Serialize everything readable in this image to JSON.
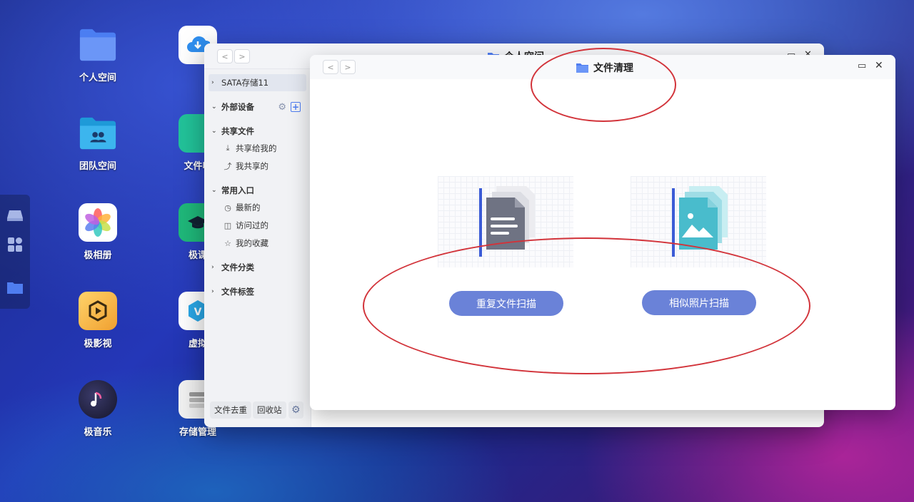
{
  "desktop": {
    "icons": [
      {
        "label": "个人空间",
        "icon": "folder-icon"
      },
      {
        "label": "团队空间",
        "icon": "team-folder-icon"
      },
      {
        "label": "极相册",
        "icon": "photos-icon"
      },
      {
        "label": "极影视",
        "icon": "video-icon"
      },
      {
        "label": "极音乐",
        "icon": "music-icon"
      },
      {
        "label": "",
        "icon": "download-icon"
      },
      {
        "label": "文件收",
        "icon": "file-collect-icon"
      },
      {
        "label": "极课",
        "icon": "graduation-cap-icon"
      },
      {
        "label": "虚拟",
        "icon": "virtual-machine-icon"
      },
      {
        "label": "存储管理",
        "icon": "storage-icon"
      }
    ]
  },
  "dock": {
    "items": [
      "drive-icon",
      "apps-grid-icon",
      "folder-icon"
    ]
  },
  "back_window": {
    "title": "个人空间",
    "sidebar": {
      "storage": "SATA存储11",
      "external": "外部设备",
      "shared": "共享文件",
      "shared_items": [
        "共享给我的",
        "我共享的"
      ],
      "common": "常用入口",
      "common_items": [
        "最新的",
        "访问过的",
        "我的收藏"
      ],
      "category": "文件分类",
      "tags": "文件标签"
    },
    "footer": {
      "dedupe": "文件去重",
      "trash": "回收站"
    }
  },
  "front_window": {
    "title": "文件清理",
    "buttons": {
      "duplicate_scan": "重复文件扫描",
      "similar_photo_scan": "相似照片扫描"
    }
  },
  "colors": {
    "accent": "#6a82d8",
    "annotation": "#d2333a"
  }
}
